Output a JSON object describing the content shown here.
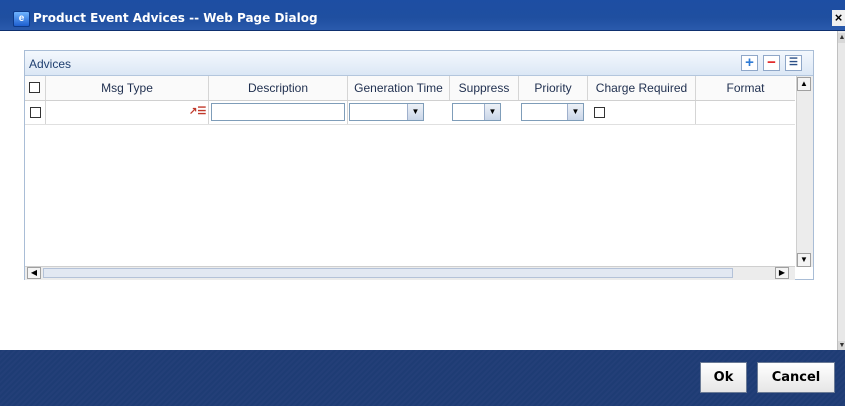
{
  "window": {
    "title": "Product Event Advices -- Web Page Dialog",
    "close_glyph": "×",
    "app_icon": "ie-dialog-icon"
  },
  "panel": {
    "title": "Advices",
    "add_glyph": "+",
    "remove_glyph": "−",
    "view_glyph": "☰"
  },
  "grid": {
    "columns": [
      "Msg Type",
      "Description",
      "Generation Time",
      "Suppress",
      "Priority",
      "Charge Required",
      "Format"
    ],
    "rows": [
      {
        "selected": false,
        "msg_type": "",
        "description": "",
        "generation_time": "",
        "suppress": "",
        "priority": "",
        "charge_required": false,
        "format": ""
      }
    ],
    "lov_glyph": "↗☰",
    "dropdown_glyph": "▼",
    "scroll_up": "▲",
    "scroll_down": "▼",
    "scroll_left": "◀",
    "scroll_right": "▶"
  },
  "footer": {
    "ok_label": "Ok",
    "cancel_label": "Cancel"
  },
  "colors": {
    "titlebar": "#1f4fa0",
    "footer": "#1e3c74",
    "panel_header": "#dbe7f5",
    "accent": "#2f7bd6"
  }
}
